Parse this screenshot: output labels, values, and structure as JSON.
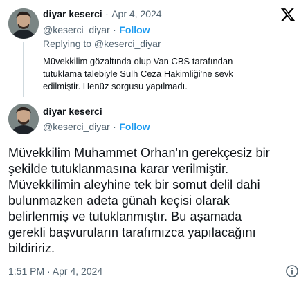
{
  "brand": {
    "logo": "x-logo-icon",
    "color": "#000000"
  },
  "quoted": {
    "author_name": "diyar keserci",
    "dot": "·",
    "date": "Apr 4, 2024",
    "handle": "@keserci_diyar",
    "sep": "·",
    "follow": "Follow",
    "replying": "Replying to @keserci_diyar",
    "lines": [
      "Müvekkilim gözaltında olup Van CBS tarafından",
      "tutuklama  talebiyle Sulh Ceza Hakimliği'ne sevk",
      "edilmiştir. Henüz sorgusu yapılmadı."
    ]
  },
  "tweet": {
    "author_name": "diyar keserci",
    "handle": "@keserci_diyar",
    "sep": "·",
    "follow": "Follow",
    "lines": [
      "Müvekkilim Muhammet Orhan'ın gerekçesiz bir",
      "şekilde tutuklanmasına karar verilmiştir.",
      "Müvekkilimin aleyhine tek bir somut delil dahi",
      "bulunmazken adeta günah keçisi olarak",
      "belirlenmiş ve tutuklanmıştır. Bu aşamada",
      "gerekli başvuruların tarafımızca yapılacağını",
      "bildiririz."
    ],
    "timestamp": "1:51 PM · Apr 4, 2024",
    "info_icon": "info-icon"
  },
  "colors": {
    "link": "#1d9bf0",
    "muted": "#536471",
    "text": "#0f1419"
  }
}
